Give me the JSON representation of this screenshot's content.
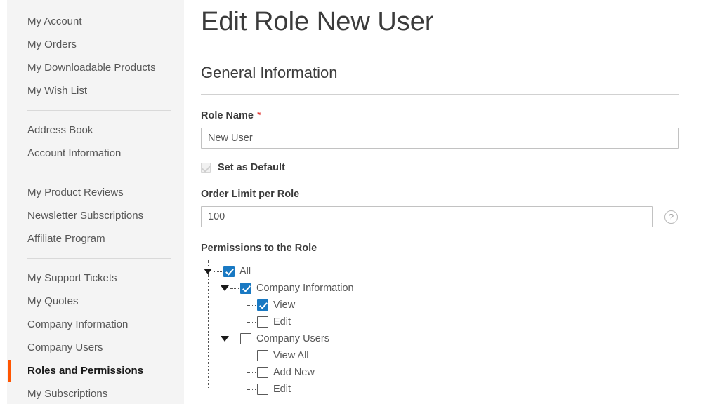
{
  "sidebar": {
    "groups": [
      {
        "items": [
          {
            "label": "My Account",
            "current": false
          },
          {
            "label": "My Orders",
            "current": false
          },
          {
            "label": "My Downloadable Products",
            "current": false
          },
          {
            "label": "My Wish List",
            "current": false
          }
        ]
      },
      {
        "items": [
          {
            "label": "Address Book",
            "current": false
          },
          {
            "label": "Account Information",
            "current": false
          }
        ]
      },
      {
        "items": [
          {
            "label": "My Product Reviews",
            "current": false
          },
          {
            "label": "Newsletter Subscriptions",
            "current": false
          },
          {
            "label": "Affiliate Program",
            "current": false
          }
        ]
      },
      {
        "items": [
          {
            "label": "My Support Tickets",
            "current": false
          },
          {
            "label": "My Quotes",
            "current": false
          },
          {
            "label": "Company Information",
            "current": false
          },
          {
            "label": "Company Users",
            "current": false
          },
          {
            "label": "Roles and Permissions",
            "current": true
          },
          {
            "label": "My Subscriptions",
            "current": false
          }
        ]
      }
    ]
  },
  "main": {
    "page_title": "Edit Role New User",
    "section_title": "General Information",
    "role_name": {
      "label": "Role Name",
      "required_marker": "*",
      "value": "New User",
      "placeholder": ""
    },
    "set_as_default": {
      "label": "Set as Default",
      "checked": true,
      "disabled": true
    },
    "order_limit": {
      "label": "Order Limit per Role",
      "value": "100",
      "placeholder": "",
      "help_icon": "question-mark-icon",
      "help_glyph": "?"
    },
    "permissions": {
      "label": "Permissions to the Role",
      "tree": [
        {
          "label": "All",
          "depth": 0,
          "checked": true,
          "expandable": true
        },
        {
          "label": "Company Information",
          "depth": 1,
          "checked": true,
          "expandable": true
        },
        {
          "label": "View",
          "depth": 2,
          "checked": true,
          "expandable": false
        },
        {
          "label": "Edit",
          "depth": 2,
          "checked": false,
          "expandable": false
        },
        {
          "label": "Company Users",
          "depth": 1,
          "checked": false,
          "expandable": true
        },
        {
          "label": "View All",
          "depth": 2,
          "checked": false,
          "expandable": false
        },
        {
          "label": "Add New",
          "depth": 2,
          "checked": false,
          "expandable": false
        },
        {
          "label": "Edit",
          "depth": 2,
          "checked": false,
          "expandable": false
        }
      ]
    }
  },
  "colors": {
    "accent_orange": "#ff5501",
    "checkbox_blue": "#1979c3",
    "required_red": "#e02b27",
    "sidebar_bg": "#f4f4f4",
    "text_gray": "#575757"
  }
}
